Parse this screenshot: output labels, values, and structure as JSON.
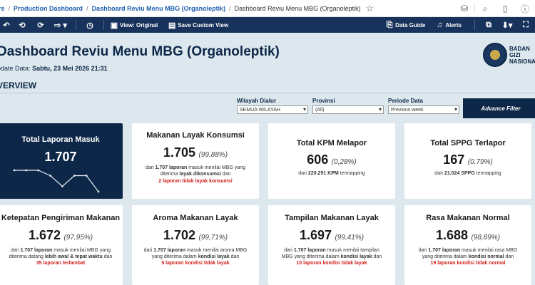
{
  "breadcrumb": {
    "root": "re",
    "items": [
      "Production Dashboard",
      "Dashboard Reviu Menu MBG (Organoleptik)"
    ],
    "current": "Dashboard Reviu Menu MBG (Organoleptik)"
  },
  "toolbar": {
    "view_original": "View: Original",
    "save_custom_view": "Save Custom View",
    "data_guide": "Data Guide",
    "alerts": "Alerts"
  },
  "header": {
    "title": "Dashboard Reviu Menu MBG (Organoleptik)",
    "update_label": "odate Data:",
    "update_value": "Sabtu, 23 Mei 2026 21:31",
    "section": "VERVIEW",
    "logo_line1": "BADAN",
    "logo_line2": "GIZI",
    "logo_line3": "NASIONA"
  },
  "filters": {
    "wilayah_label": "Wilayah Dialur",
    "wilayah_value": "SEMUA WILAYAH",
    "provinsi_label": "Provinsi",
    "provinsi_value": "(All)",
    "periode_label": "Periode Data",
    "periode_value": "Previous week",
    "advance_button": "Advance Filter"
  },
  "cards": {
    "total_laporan": {
      "title": "Total Laporan Masuk",
      "value": "1.707"
    },
    "layak_konsumsi": {
      "title": "Makanan Layak Konsumsi",
      "value": "1.705",
      "pct": "(99,88%)",
      "d1": "dari ",
      "d1b": "1.707 laporan",
      "d1c": " masuk menilai MBG yang",
      "d2": "diterima ",
      "d2b": "layak dikonsumsi",
      "d2c": " dan",
      "red": "2",
      "red_rest": " laporan tidak layak konsumsi"
    },
    "kpm": {
      "title": "Total KPM Melapor",
      "value": "606",
      "pct": "(0,28%)",
      "d1": "dari ",
      "d1b": "220.251 KPM",
      "d1c": " termapping"
    },
    "sppg": {
      "title": "Total SPPG Terlapor",
      "value": "167",
      "pct": "(0,79%)",
      "d1": "dari ",
      "d1b": "21.024 SPPG",
      "d1c": " termapping"
    },
    "ketepatan": {
      "title": "Ketepatan Pengiriman Makanan",
      "value": "1.672",
      "pct": "(97,95%)",
      "d1": "dari ",
      "d1b": "1.707 laporan",
      "d1c": " masuk menilai MBG yang",
      "d2": "diterima datang ",
      "d2b": "lebih awal & tepat waktu",
      "d2c": " dan",
      "red": "35",
      "red_rest": " laporan terlambat"
    },
    "aroma": {
      "title": "Aroma Makanan Layak",
      "value": "1.702",
      "pct": "(99,71%)",
      "d1": "dari ",
      "d1b": "1.707 laporan",
      "d1c": " masuk menilai aroma MBG",
      "d2": "yang diterima dalam ",
      "d2b": "kondisi layak",
      "d2c": " dan",
      "red": "5",
      "red_rest": " laporan kondisi tidak layak"
    },
    "tampilan": {
      "title": "Tampilan Makanan Layak",
      "value": "1.697",
      "pct": "(99,41%)",
      "d1": "dari ",
      "d1b": "1.707 laporan",
      "d1c": " masuk menilai tampilan",
      "d2": "MBG yang diterima dalam ",
      "d2b": "kondisi layak",
      "d2c": " dan",
      "red": "10",
      "red_rest": " laporan kondisi tidak layak"
    },
    "rasa": {
      "title": "Rasa Makanan Normal",
      "value": "1.688",
      "pct": "(98,89%)",
      "d1": "dari ",
      "d1b": "1.707 laporan",
      "d1c": " masuk menilai rasa MBG",
      "d2": "yang diterima dalam ",
      "d2b": "kondisi normal",
      "d2c": " dan",
      "red": "19",
      "red_rest": " laporan kondisi tidak normal"
    }
  },
  "sparkline": {
    "values": [
      5,
      5,
      5,
      4,
      2,
      4,
      4,
      1
    ]
  },
  "colors": {
    "navy": "#0d2748",
    "toolbar": "#17325b",
    "bg": "#dde8ee",
    "alert_red": "#d0201a"
  }
}
